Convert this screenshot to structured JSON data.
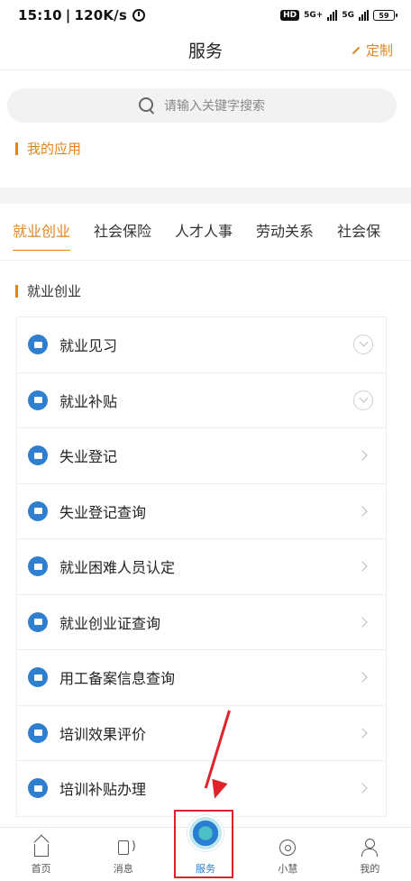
{
  "status_bar": {
    "time": "15:10",
    "speed": "120K/s",
    "hd": "HD",
    "net1": "5G+",
    "net2": "5G",
    "battery": "59"
  },
  "header": {
    "title": "服务",
    "customize_label": "定制"
  },
  "search": {
    "placeholder": "请输入关键字搜索"
  },
  "my_apps": {
    "title": "我的应用"
  },
  "tabs": [
    "就业创业",
    "社会保险",
    "人才人事",
    "劳动关系",
    "社会保"
  ],
  "category": {
    "title": "就业创业"
  },
  "items": [
    {
      "label": "就业见习",
      "icon": "briefcase-icon",
      "action": "expand"
    },
    {
      "label": "就业补贴",
      "icon": "briefcase-icon",
      "action": "expand"
    },
    {
      "label": "失业登记",
      "icon": "badge-icon",
      "action": "chevron"
    },
    {
      "label": "失业登记查询",
      "icon": "search-doc-icon",
      "action": "chevron"
    },
    {
      "label": "就业困难人员认定",
      "icon": "person-icon",
      "action": "chevron"
    },
    {
      "label": "就业创业证查询",
      "icon": "certificate-icon",
      "action": "chevron"
    },
    {
      "label": "用工备案信息查询",
      "icon": "briefcase-icon",
      "action": "chevron"
    },
    {
      "label": "培训效果评价",
      "icon": "briefcase-icon",
      "action": "chevron"
    },
    {
      "label": "培训补贴办理",
      "icon": "briefcase-icon",
      "action": "chevron"
    }
  ],
  "bottom_nav": [
    {
      "label": "首页",
      "icon": "home-icon"
    },
    {
      "label": "消息",
      "icon": "message-icon"
    },
    {
      "label": "服务",
      "icon": "service-logo-icon"
    },
    {
      "label": "小慧",
      "icon": "assistant-icon"
    },
    {
      "label": "我的",
      "icon": "user-icon"
    }
  ],
  "colors": {
    "accent": "#e2841c",
    "icon_blue": "#2f7fd1",
    "annotation_red": "#e0232a"
  }
}
